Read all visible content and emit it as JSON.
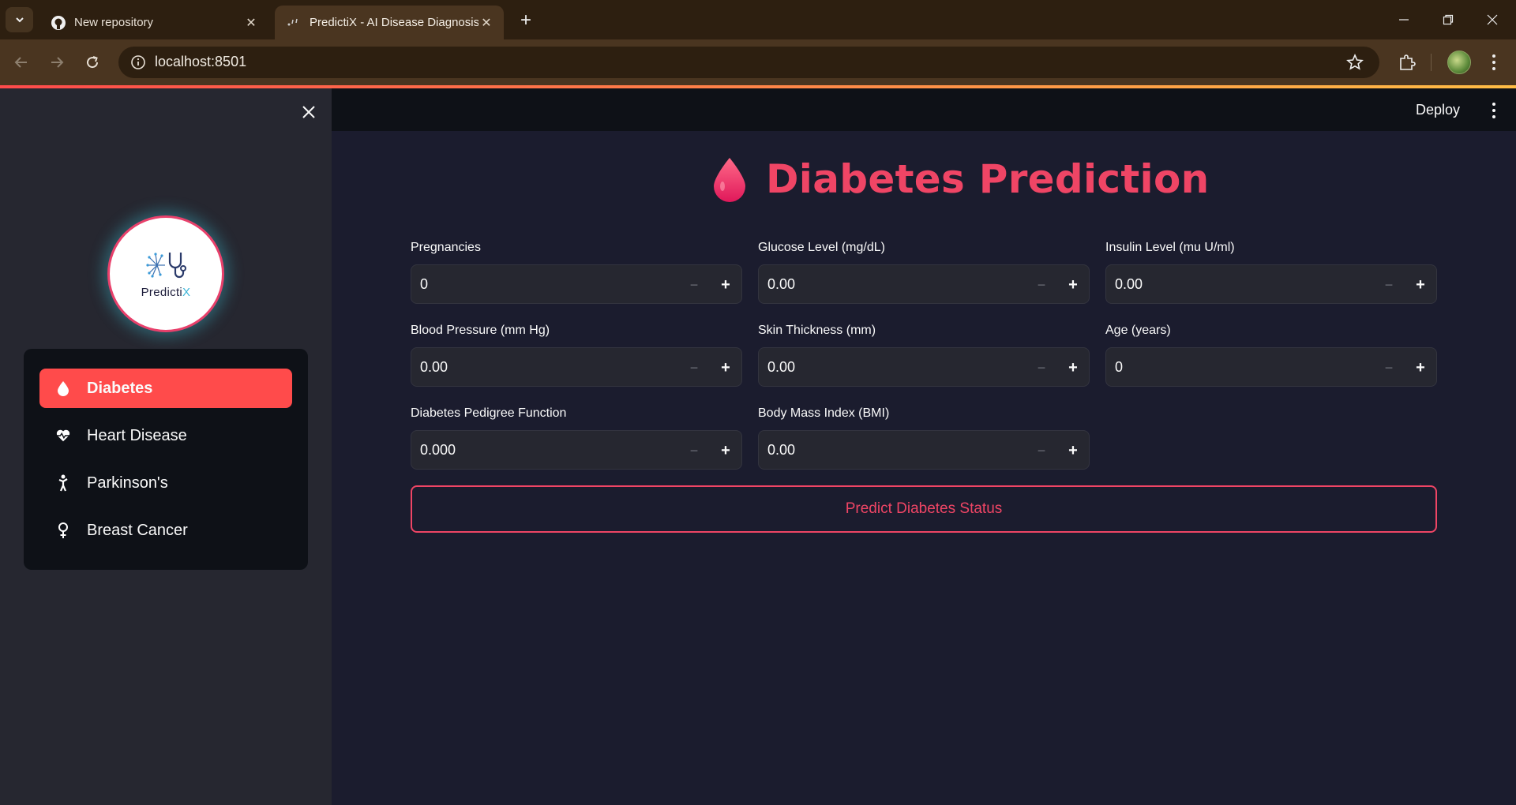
{
  "browser": {
    "tabs": [
      {
        "title": "New repository",
        "active": false
      },
      {
        "title": "PredictiX - AI Disease Diagnosis",
        "active": true
      }
    ],
    "url": "localhost:8501"
  },
  "sidebar": {
    "logo": {
      "text_main": "Predicti",
      "text_accent": "X"
    },
    "items": [
      {
        "label": "Diabetes",
        "icon": "drop-icon",
        "active": true
      },
      {
        "label": "Heart Disease",
        "icon": "heart-pulse-icon",
        "active": false
      },
      {
        "label": "Parkinson's",
        "icon": "person-icon",
        "active": false
      },
      {
        "label": "Breast Cancer",
        "icon": "female-icon",
        "active": false
      }
    ]
  },
  "header": {
    "deploy_label": "Deploy"
  },
  "main": {
    "title": "Diabetes Prediction",
    "fields": [
      {
        "label": "Pregnancies",
        "value": "0"
      },
      {
        "label": "Glucose Level (mg/dL)",
        "value": "0.00"
      },
      {
        "label": "Insulin Level (mu U/ml)",
        "value": "0.00"
      },
      {
        "label": "Blood Pressure (mm Hg)",
        "value": "0.00"
      },
      {
        "label": "Skin Thickness (mm)",
        "value": "0.00"
      },
      {
        "label": "Age (years)",
        "value": "0"
      },
      {
        "label": "Diabetes Pedigree Function",
        "value": "0.000"
      },
      {
        "label": "Body Mass Index (BMI)",
        "value": "0.00"
      }
    ],
    "predict_label": "Predict Diabetes Status"
  },
  "colors": {
    "accent": "#ff4b4b",
    "title": "#ef4565",
    "background": "#1b1c2e",
    "sidebar": "#262730"
  }
}
